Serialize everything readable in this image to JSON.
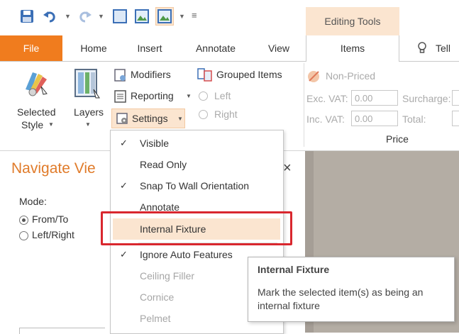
{
  "quick_access": {
    "icons": [
      "save-icon",
      "undo-icon",
      "redo-icon",
      "window-icon",
      "image-icon",
      "image-selected-icon",
      "customize-icon"
    ]
  },
  "contextual_header": "Editing Tools",
  "tabs": {
    "file": "File",
    "home": "Home",
    "insert": "Insert",
    "annotate": "Annotate",
    "view": "View",
    "items": "Items",
    "tell": "Tell"
  },
  "ribbon": {
    "selected_style": "Selected",
    "selected_style_2": "Style",
    "layers": "Layers",
    "modifiers": "Modifiers",
    "grouped_items": "Grouped Items",
    "reporting": "Reporting",
    "settings": "Settings",
    "left": "Left",
    "right": "Right",
    "non_priced": "Non-Priced",
    "exc_vat_label": "Exc. VAT:",
    "exc_vat_value": "0.00",
    "inc_vat_label": "Inc. VAT:",
    "inc_vat_value": "0.00",
    "surcharge_label": "Surcharge:",
    "total_label": "Total:",
    "price_group": "Price"
  },
  "nav_panel": {
    "title": "Navigate Vie",
    "close": "×",
    "mode_label": "Mode:",
    "from_to": "From/To",
    "left_right": "Left/Right"
  },
  "menu": {
    "items": [
      {
        "label": "Visible",
        "checked": true,
        "enabled": true
      },
      {
        "label": "Read Only",
        "checked": false,
        "enabled": true
      },
      {
        "label": "Snap To Wall Orientation",
        "checked": true,
        "enabled": true
      },
      {
        "label": "Annotate",
        "checked": false,
        "enabled": true
      },
      {
        "label": "Internal Fixture",
        "checked": false,
        "enabled": true,
        "highlighted": true
      },
      {
        "label": "Ignore Auto Features",
        "checked": true,
        "enabled": true
      },
      {
        "label": "Ceiling Filler",
        "checked": false,
        "enabled": false
      },
      {
        "label": "Cornice",
        "checked": false,
        "enabled": false
      },
      {
        "label": "Pelmet",
        "checked": false,
        "enabled": false
      }
    ]
  },
  "tooltip": {
    "title": "Internal Fixture",
    "description": "Mark the selected item(s) as being an internal fixture"
  },
  "colors": {
    "accent_orange": "#f07c1e",
    "highlight": "#fbe5d0",
    "red_box": "#d9272e"
  }
}
